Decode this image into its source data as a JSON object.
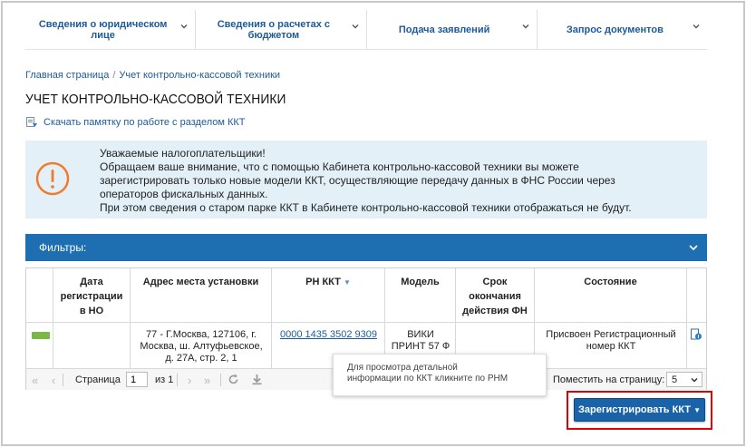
{
  "topnav": [
    {
      "label": "Сведения о юридическом лице"
    },
    {
      "label": "Сведения о расчетах с бюджетом"
    },
    {
      "label": "Подача заявлений"
    },
    {
      "label": "Запрос документов"
    }
  ],
  "breadcrumb": {
    "home": "Главная страница",
    "separator": "/",
    "current": "Учет контрольно-кассовой техники"
  },
  "page_title": "УЧЕТ КОНТРОЛЬНО-КАССОВОЙ ТЕХНИКИ",
  "download_link": "Скачать памятку по работе с разделом ККТ",
  "notice": {
    "lines": [
      "Уважаемые налогоплательщики!",
      "Обращаем ваше внимание, что с помощью Кабинета контрольно-кассовой техники вы можете",
      "зарегистрировать только новые модели ККТ, осуществляющие передачу данных в ФНС России через",
      "операторов фискальных данных.",
      "При этом сведения о старом парке ККТ в Кабинете контрольно-кассовой техники отображаться не будут."
    ],
    "icon": "exclamation-circle-icon",
    "icon_color": "#f07c2b",
    "bg_color": "#e3f0f8"
  },
  "filters": {
    "label": "Фильтры:",
    "bg_color": "#1e6fb1"
  },
  "table": {
    "headers": {
      "date": [
        "Дата",
        "регистрации",
        "в НО"
      ],
      "address": "Адрес места установки",
      "rn": "РН ККТ",
      "model": "Модель",
      "expiry": [
        "Срок",
        "окончания",
        "действия ФН"
      ],
      "state": "Состояние"
    },
    "rows": [
      {
        "status_color": "#7ab648",
        "date": "",
        "address": [
          "77 - Г.Москва, 127106, г.",
          "Москва, ш. Алтуфьевское,",
          "д. 27А, стр. 2, 1"
        ],
        "rn": "0000 1435 3502 9309",
        "model": [
          "ВИКИ",
          "ПРИНТ 57 Ф"
        ],
        "expiry": "",
        "state": [
          "Присвоен Регистрационный",
          "номер ККТ"
        ]
      }
    ]
  },
  "pager": {
    "page_label": "Страница",
    "page_value": "1",
    "of_label": "из 1",
    "per_page_label": "Поместить на страницу:",
    "per_page_value": "5"
  },
  "tooltip": [
    "Для просмотра детальной",
    "информации по ККТ кликните по РНМ"
  ],
  "register_button": "Зарегистрировать ККТ",
  "accent_color": "#1e5a96"
}
